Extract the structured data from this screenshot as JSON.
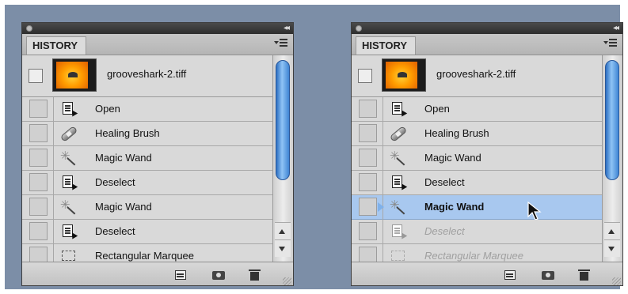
{
  "panels": [
    {
      "tab_label": "HISTORY",
      "snapshot_name": "grooveshark-2.tiff",
      "steps": [
        {
          "label": "Open",
          "icon": "document-icon",
          "state": "normal"
        },
        {
          "label": "Healing Brush",
          "icon": "bandage-icon",
          "state": "normal"
        },
        {
          "label": "Magic Wand",
          "icon": "magic-wand-icon",
          "state": "normal"
        },
        {
          "label": "Deselect",
          "icon": "document-icon",
          "state": "normal"
        },
        {
          "label": "Magic Wand",
          "icon": "magic-wand-icon",
          "state": "normal"
        },
        {
          "label": "Deselect",
          "icon": "document-icon",
          "state": "normal"
        },
        {
          "label": "Rectangular Marquee",
          "icon": "marquee-icon",
          "state": "normal"
        }
      ]
    },
    {
      "tab_label": "HISTORY",
      "snapshot_name": "grooveshark-2.tiff",
      "steps": [
        {
          "label": "Open",
          "icon": "document-icon",
          "state": "normal"
        },
        {
          "label": "Healing Brush",
          "icon": "bandage-icon",
          "state": "normal"
        },
        {
          "label": "Magic Wand",
          "icon": "magic-wand-icon",
          "state": "normal"
        },
        {
          "label": "Deselect",
          "icon": "document-icon",
          "state": "normal"
        },
        {
          "label": "Magic Wand",
          "icon": "magic-wand-icon",
          "state": "active"
        },
        {
          "label": "Deselect",
          "icon": "document-icon",
          "state": "undone"
        },
        {
          "label": "Rectangular Marquee",
          "icon": "marquee-icon",
          "state": "undone"
        }
      ]
    }
  ],
  "colors": {
    "background": "#7c8ea7",
    "panel": "#d6d6d6",
    "selection": "#a8c8ef",
    "scrollbar_thumb": "#4a90de",
    "thumbnail_orange": "#ff9d00"
  }
}
